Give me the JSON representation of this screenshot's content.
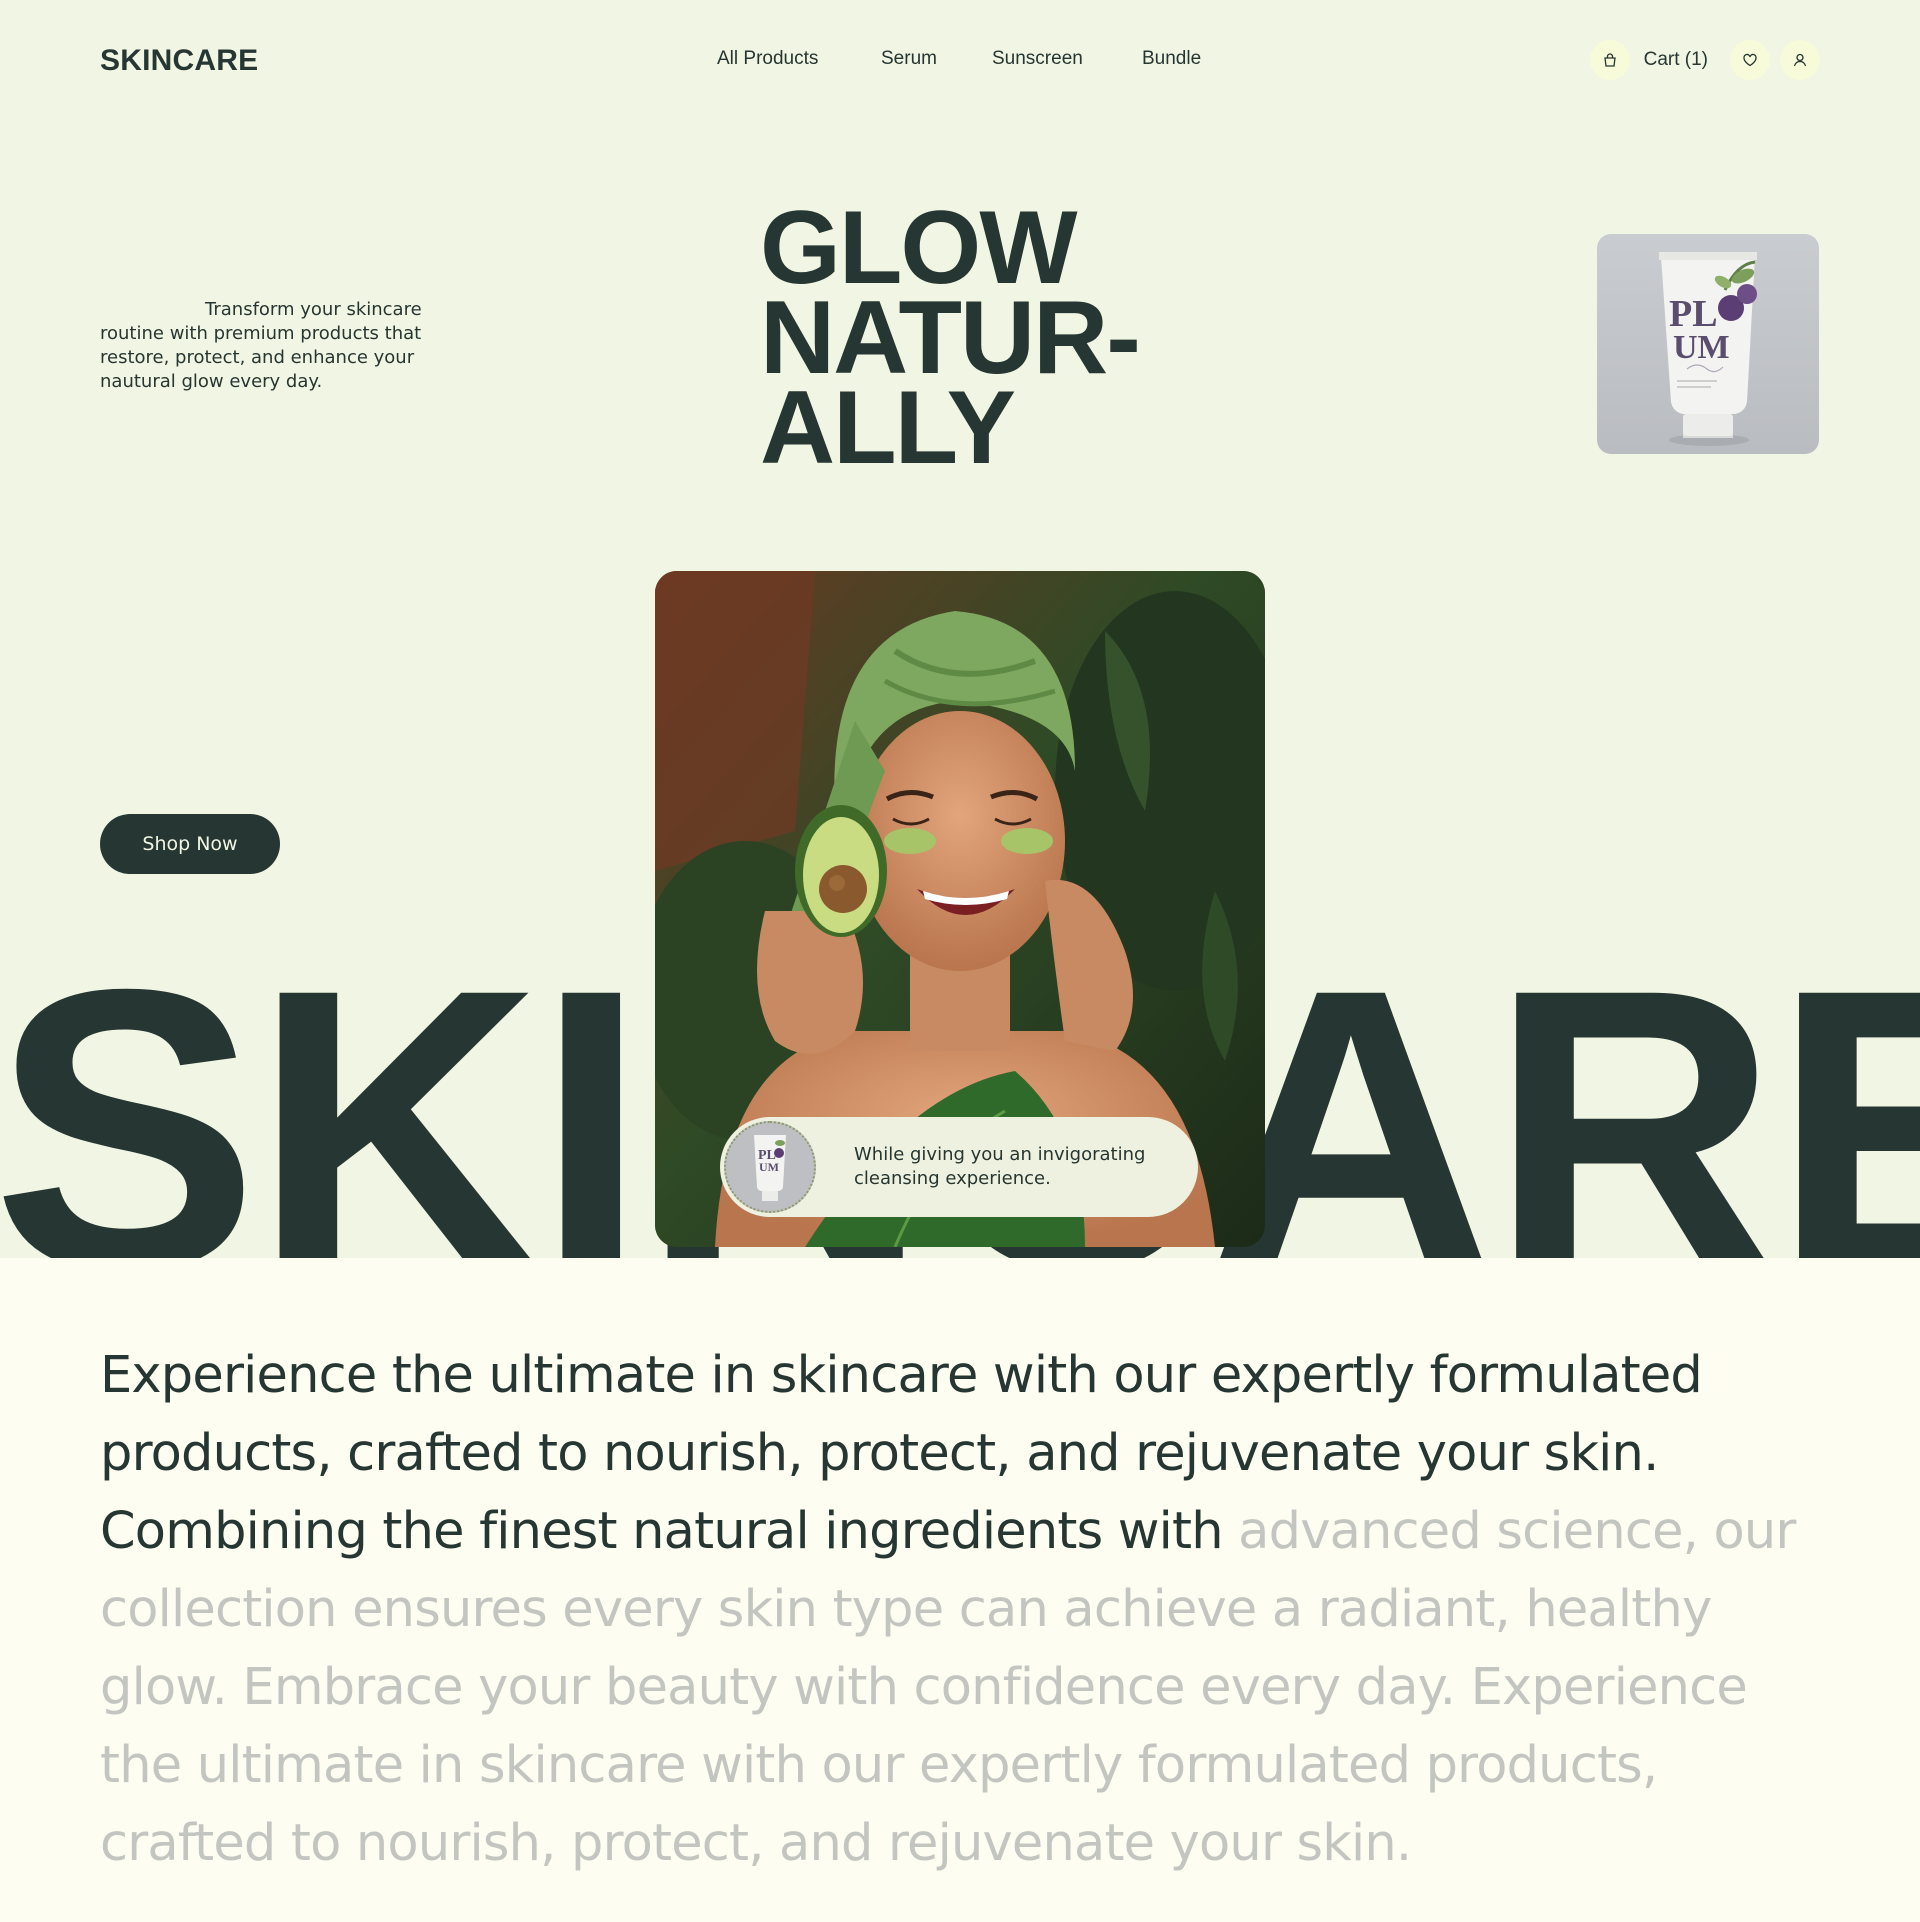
{
  "nav": {
    "logo": "SKINCARE",
    "links": [
      "All Products",
      "Serum",
      "Sunscreen",
      "Bundle"
    ],
    "cart_label": "Cart (1)",
    "icons": [
      "bag-icon",
      "heart-icon",
      "user-icon"
    ]
  },
  "hero": {
    "intro": "Transform your skincare routine with premium products that restore, protect, and enhance your nautural glow every day.",
    "headline": [
      "GLOW",
      "NATUR-",
      "ALLY"
    ],
    "shop_button": "Shop Now",
    "big_word": "SKINCARE",
    "product_brand": "PLUM",
    "pill_text": "While giving you an invigorating cleansing experience."
  },
  "about": {
    "dark_text": "Experience the ultimate in skincare with our expertly formulated products, crafted to nourish, protect, and rejuvenate your skin. Combining the finest natural ingredients with",
    "light_text": " advanced science, our collection ensures every skin type can achieve a radiant, healthy glow. Embrace your beauty with confidence every day. Experience the ultimate in skincare with our expertly formulated products, crafted to nourish, protect, and rejuvenate your skin."
  },
  "colors": {
    "dark_green": "#263632",
    "hero_bg": "#f1f5e3",
    "page_bg": "#fdfdf2",
    "muted_text": "#c3c5c1"
  }
}
